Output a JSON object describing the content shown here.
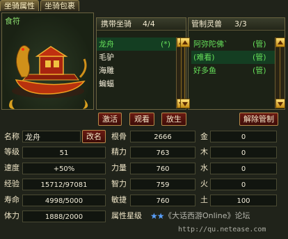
{
  "tabs": [
    "坐骑属性",
    "坐骑包裹"
  ],
  "portrait": {
    "label": "食符"
  },
  "carried": {
    "header_title": "携带坐骑",
    "header_count": "4/4",
    "items": [
      {
        "name": "龙舟",
        "tag": "(*)",
        "selected": true
      },
      {
        "name": "毛驴",
        "tag": ""
      },
      {
        "name": "海雕",
        "tag": ""
      },
      {
        "name": "蝙蝠",
        "tag": ""
      }
    ]
  },
  "spirits": {
    "header_title": "管制灵兽",
    "header_count": "3/3",
    "items": [
      {
        "name": "阿弥陀佛`",
        "tag": "(管)"
      },
      {
        "name": "(难看)",
        "tag": "(管)"
      },
      {
        "name": "好多鱼",
        "tag": "(管)"
      }
    ]
  },
  "buttons": {
    "activate": "激活",
    "view": "观看",
    "release": "放生",
    "unmanage": "解除管制",
    "rename": "改名"
  },
  "stats": {
    "name_label": "名称",
    "name_value": "龙舟",
    "level_label": "等级",
    "level_value": "51",
    "speed_label": "速度",
    "speed_value": "+50%",
    "exp_label": "经验",
    "exp_value": "15712/97081",
    "life_label": "寿命",
    "life_value": "4998/5000",
    "stamina_label": "体力",
    "stamina_value": "1888/2000"
  },
  "attrs": {
    "bone_label": "根骨",
    "bone_value": "2666",
    "energy_label": "精力",
    "energy_value": "763",
    "power_label": "力量",
    "power_value": "760",
    "wisdom_label": "智力",
    "wisdom_value": "759",
    "agility_label": "敏捷",
    "agility_value": "760",
    "star_label": "属性星级"
  },
  "elements": {
    "metal_label": "金",
    "metal_value": "0",
    "wood_label": "木",
    "wood_value": "0",
    "water_label": "水",
    "water_value": "0",
    "fire_label": "火",
    "fire_value": "0",
    "earth_label": "土",
    "earth_value": "100"
  },
  "watermark": {
    "line1": "《大话西游Online》论坛",
    "line2": "http://qu.netease.com"
  }
}
